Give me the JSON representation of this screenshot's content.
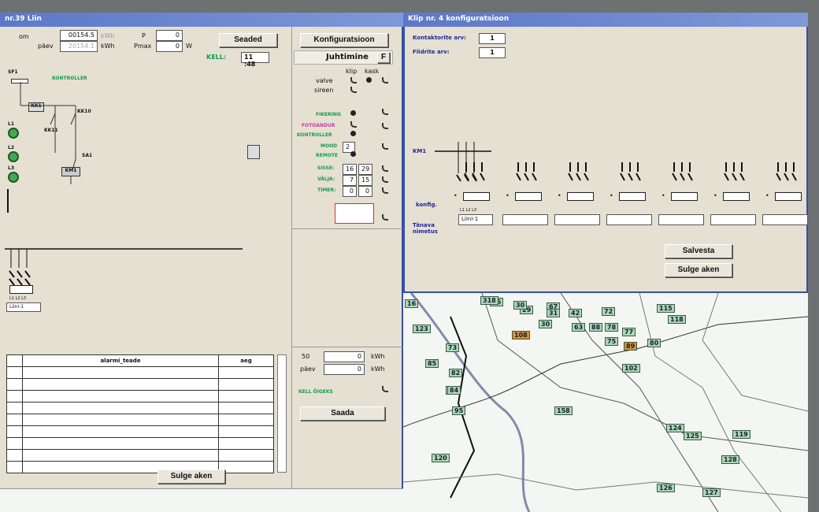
{
  "left_window": {
    "title": "nr.39 Liin",
    "meter": {
      "id_label": "om",
      "reading_top": "00154.5",
      "reading_bottom": "20154.1",
      "kwh_label": "kWh",
      "paev_label": "päev",
      "p_label": "P",
      "p_value": "0",
      "pmax_label": "Pmax",
      "pmax_value": "0",
      "w_label": "W"
    },
    "seaded_button": "Seaded",
    "kell_label": "KELL:",
    "kell_value": "11 :48",
    "schematic": {
      "sf1_label": "SF1",
      "kontroller_label": "KONTROLLER",
      "kk1_label": "KK1",
      "kk10_label": "KK10",
      "kk11_label": "KK11",
      "sa1_label": "SA1",
      "km1_label": "KM1",
      "l1": "L1",
      "l2": "L2",
      "l3": "L3",
      "phase_labels": "L1 L2 L3",
      "line_name": "Liini-1"
    },
    "alarm_table": {
      "col_alarm": "alarmi_teade",
      "col_aeg": "aeg",
      "rows": [
        "",
        "",
        "",
        "",
        "",
        "",
        "",
        "",
        ""
      ]
    },
    "sulge_button": "Sulge aken"
  },
  "control_panel": {
    "konfiguratsioon_button": "Konfiguratsioon",
    "juhtimine_label": "Juhtimine",
    "juhtimine_btn": "F",
    "klip_label": "klip",
    "kask_label": "kask",
    "valve_label": "valve",
    "sireen_label": "sireen",
    "fikeerimine": "FIKERING",
    "fotoandur": "FOTOANDUR",
    "kontroller": "KONTROLLER",
    "mood_label": "MOOD",
    "mood_value": "2",
    "remote": "REMOTE",
    "sisse_label": "SISSE:",
    "sisse_h": "16",
    "sisse_m": "29",
    "valja_label": "VÄLJA:",
    "valja_h": "7",
    "valja_m": "15",
    "timer_label": "TIMER:",
    "timer_h": "0",
    "timer_m": "0",
    "energy_kokku": "50",
    "energy_kokku_val": "0",
    "energy_paev": "päev",
    "energy_paev_val": "0",
    "kwh": "kWh",
    "kell_ogeks": "KELL ÕIGEKS",
    "saada_button": "Saada"
  },
  "config_window": {
    "title": "Klip nr. 4 konfiguratsioon",
    "kontaktorite_label": "Kontaktorite arv:",
    "kontaktorite_value": "1",
    "fiidrite_label": "Fiidrite arv:",
    "fiidrite_value": "1",
    "km1_label": "KM1",
    "konfig_label": "konfig.",
    "phase_labels": "L1 L2 L3",
    "tanava_label": "Tänava nimetus",
    "feeder_names": [
      "Liini-1",
      "",
      "",
      "",
      "",
      "",
      ""
    ],
    "salvesta_button": "Salvesta",
    "sulge_button": "Sulge aken"
  },
  "map": {
    "labels": [
      {
        "text": "16"
      },
      {
        "text": "86"
      },
      {
        "text": "29"
      },
      {
        "text": "67"
      },
      {
        "text": "42"
      },
      {
        "text": "72"
      },
      {
        "text": "115"
      },
      {
        "text": "118"
      },
      {
        "text": "123"
      },
      {
        "text": "30"
      },
      {
        "text": "63"
      },
      {
        "text": "88"
      },
      {
        "text": "78"
      },
      {
        "text": "77"
      },
      {
        "text": "108"
      },
      {
        "text": "75"
      },
      {
        "text": "89"
      },
      {
        "text": "80"
      },
      {
        "text": "73"
      },
      {
        "text": "102"
      },
      {
        "text": "85"
      },
      {
        "text": "82"
      },
      {
        "text": "84"
      },
      {
        "text": "84"
      },
      {
        "text": "95"
      },
      {
        "text": "158"
      },
      {
        "text": "124"
      },
      {
        "text": "125"
      },
      {
        "text": "119"
      },
      {
        "text": "128"
      },
      {
        "text": "120"
      },
      {
        "text": "126"
      },
      {
        "text": "127"
      },
      {
        "text": "318"
      },
      {
        "text": "30"
      },
      {
        "text": "31"
      }
    ]
  }
}
